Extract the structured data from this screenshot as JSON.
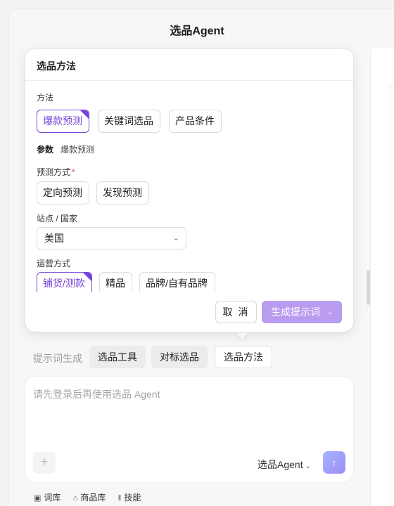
{
  "app": {
    "title": "选品Agent"
  },
  "popover": {
    "title": "选品方法",
    "method_label": "方法",
    "methods": [
      {
        "label": "爆款预测",
        "active": true
      },
      {
        "label": "关键词选品",
        "active": false
      },
      {
        "label": "产品条件",
        "active": false
      }
    ],
    "params_label": "参数",
    "params_value": "爆款预测",
    "predict_label": "预测方式",
    "required_mark": "*",
    "predict_options": [
      "定向预测",
      "发现预测"
    ],
    "site_label": "站点 / 国家",
    "site_value": "美国",
    "ops_label": "运营方式",
    "ops_options": [
      {
        "label": "铺货/测款",
        "active": true
      },
      {
        "label": "精品",
        "active": false
      },
      {
        "label": "品牌/自有品牌",
        "active": false
      }
    ],
    "cancel_label": "取 消",
    "generate_label": "生成提示词"
  },
  "prompt_bar": {
    "label": "提示词生成",
    "tabs": [
      {
        "label": "选品工具",
        "selected": false
      },
      {
        "label": "对标选品",
        "selected": false
      },
      {
        "label": "选品方法",
        "selected": true
      }
    ]
  },
  "input": {
    "placeholder": "请先登录后再使用选品 Agent",
    "plus": "+",
    "agent_select": "选品Agent",
    "send_icon": "↑"
  },
  "bottom": {
    "items": [
      {
        "icon": "dictionary-icon",
        "label": "词库"
      },
      {
        "icon": "product-library-icon",
        "label": "商品库"
      },
      {
        "icon": "skills-icon",
        "label": "技能"
      }
    ]
  },
  "colors": {
    "accent": "#7443d8",
    "generate_bg": "#b99bf0"
  }
}
